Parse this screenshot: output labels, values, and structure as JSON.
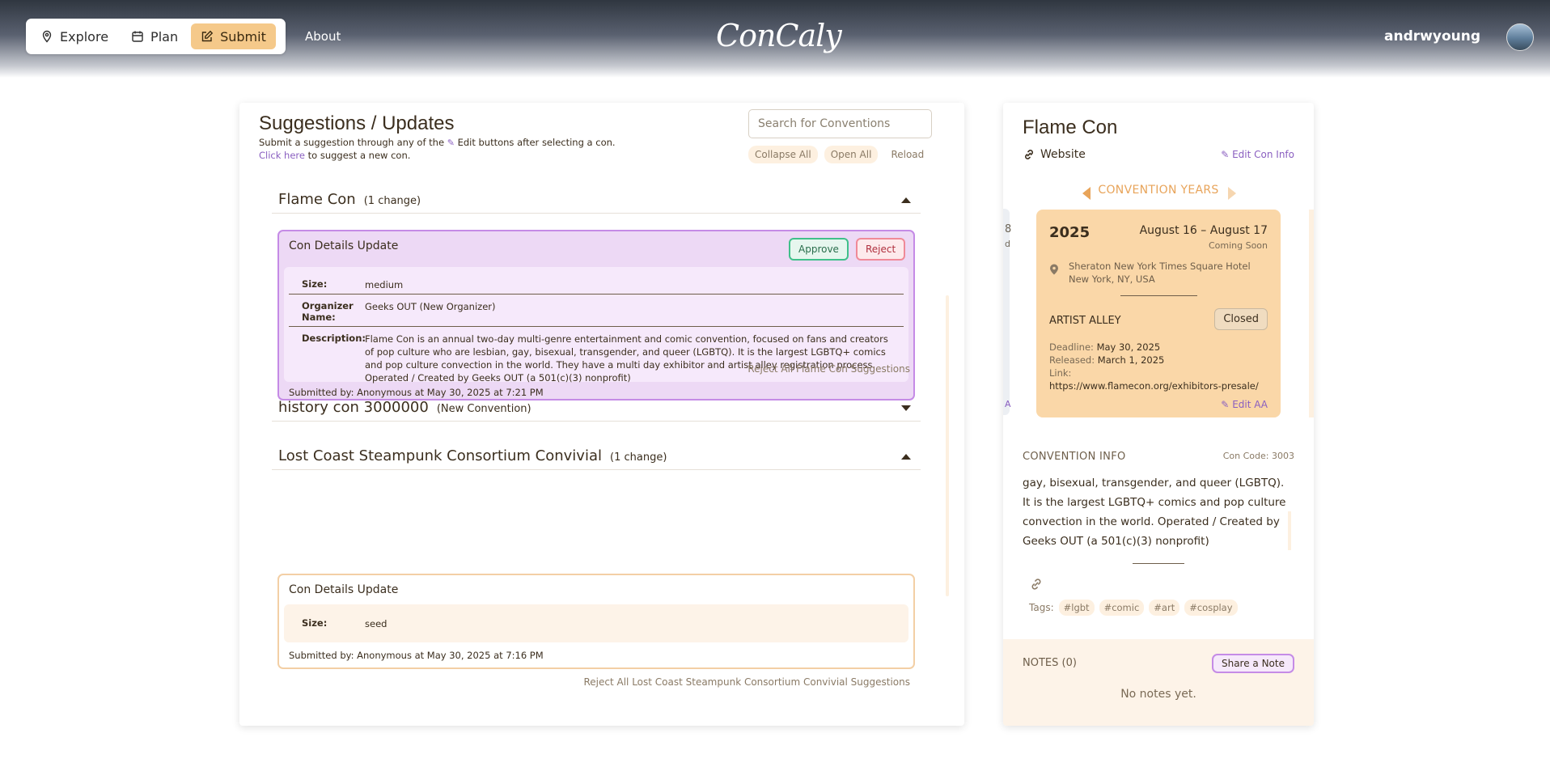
{
  "nav": {
    "explore": "Explore",
    "plan": "Plan",
    "submit": "Submit",
    "about": "About",
    "logo": "ConCaly",
    "username": "andrwyoung"
  },
  "main": {
    "title": "Suggestions / Updates",
    "subtitle_pre": "Submit a suggestion through any of the",
    "subtitle_post": "Edit buttons after selecting a con.",
    "click_here": "Click here",
    "suggest_new": "to suggest a new con.",
    "search_placeholder": "Search for Conventions",
    "collapse_all": "Collapse All",
    "open_all": "Open All",
    "reload": "Reload"
  },
  "groups": [
    {
      "name": "Flame Con",
      "count": "(1 change)",
      "expanded": true,
      "card": {
        "title": "Con Details Update",
        "approve": "Approve",
        "reject": "Reject",
        "fields": [
          {
            "label": "Size:",
            "value": "medium"
          },
          {
            "label": "Organizer Name:",
            "value": "Geeks OUT (New Organizer)"
          },
          {
            "label": "Description:",
            "value": "Flame Con is an annual two-day multi-genre entertainment and comic convention, focused on fans and creators of pop culture who are lesbian, gay, bisexual, transgender, and queer (LGBTQ). It is the largest LGBTQ+ comics and pop culture convection in the world. They have a multi day exhibitor and artist alley registration process. Operated / Created by Geeks OUT (a 501(c)(3) nonprofit)"
          }
        ],
        "submitted": "Submitted by: Anonymous at May 30, 2025 at 7:21 PM"
      },
      "reject_all": "Reject All Flame Con Suggestions"
    },
    {
      "name": "history con 3000000",
      "count": "(New Convention)",
      "expanded": false
    },
    {
      "name": "Lost Coast Steampunk Consortium Convivial",
      "count": "(1 change)",
      "expanded": true,
      "card": {
        "title": "Con Details Update",
        "fields": [
          {
            "label": "Size:",
            "value": "seed"
          }
        ],
        "submitted": "Submitted by: Anonymous at May 30, 2025 at 7:16 PM"
      },
      "reject_all": "Reject All Lost Coast Steampunk Consortium Convivial Suggestions"
    }
  ],
  "side": {
    "title": "Flame Con",
    "website": "Website",
    "edit_con_info": "Edit Con Info",
    "years_label": "CONVENTION YEARS",
    "prev_fragments": [
      "8",
      "d",
      "A"
    ],
    "year": {
      "year": "2025",
      "dates": "August 16 – August 17",
      "status": "Coming Soon",
      "venue_line1": "Sheraton New York Times Square Hotel",
      "venue_line2": "New York, NY, USA",
      "aa_label": "ARTIST ALLEY",
      "aa_status": "Closed",
      "deadline_label": "Deadline:",
      "deadline": "May 30, 2025",
      "released_label": "Released:",
      "released": "March 1, 2025",
      "link_label": "Link:",
      "link": "https://www.flamecon.org/exhibitors-presale/",
      "edit_aa": "Edit AA"
    },
    "info_head": "CONVENTION INFO",
    "con_code": "Con Code: 3003",
    "info_text": "gay, bisexual, transgender, and queer (LGBTQ). It is the largest LGBTQ+ comics and pop culture convection in the world. Operated / Created by Geeks OUT (a 501(c)(3) nonprofit)",
    "tags_label": "Tags:",
    "tags": [
      "#lgbt",
      "#comic",
      "#art",
      "#cosplay"
    ],
    "notes_head": "NOTES (0)",
    "share_note": "Share a Note",
    "no_notes": "No notes yet."
  },
  "colors": {
    "accent_submit": "#f5c98a",
    "purple_card": "#edd9f5",
    "purple_border": "#c58be6",
    "peach_card_border": "#f3cfa5",
    "year_card": "#fad7a8",
    "approve": "#40c08a",
    "reject": "#f08a98"
  }
}
